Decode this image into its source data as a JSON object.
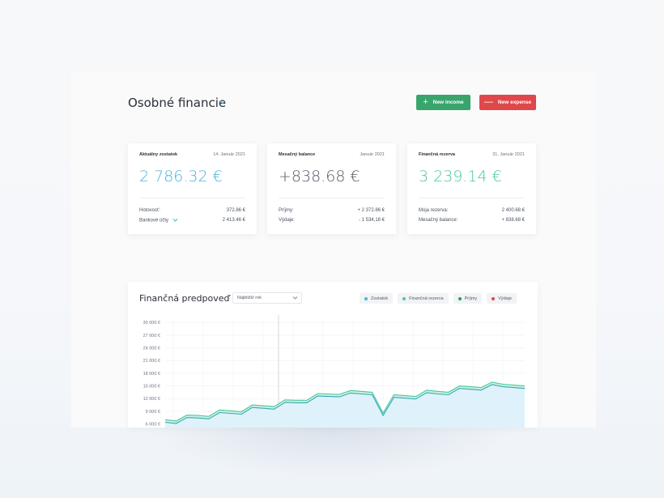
{
  "header": {
    "title": "Osobné financie",
    "new_income": "New income",
    "new_expense": "New expense"
  },
  "cards": [
    {
      "title": "Aktuálny zostatok",
      "date": "14. Január 2021",
      "amount": "2 786.32 €",
      "rows": [
        {
          "label": "Hotovosť:",
          "value": "372.86 €"
        },
        {
          "label": "Bankové účty",
          "value": "2 413.46 €"
        }
      ]
    },
    {
      "title": "Mesačný balance",
      "date": "Január 2021",
      "amount": "+838.68 €",
      "rows": [
        {
          "label": "Príjmy:",
          "value": "+ 2 372.86 €"
        },
        {
          "label": "Výdaje:",
          "value": "- 1 534,18 €"
        }
      ]
    },
    {
      "title": "Finančná rezerva",
      "date": "31. Január 2021",
      "amount": "3 239.14 €",
      "rows": [
        {
          "label": "Moja rezerva:",
          "value": "2 400.68 €"
        },
        {
          "label": "Mesačný balance:",
          "value": "+ 838.68 €"
        }
      ]
    }
  ],
  "forecast": {
    "title": "Finančná predpoveď",
    "period": "Najbližší rok",
    "legend": [
      {
        "label": "Zostatok",
        "color": "#4db3dc"
      },
      {
        "label": "Finančná rezerva",
        "color": "#48c99a"
      },
      {
        "label": "Príjmy",
        "color": "#2e9c66"
      },
      {
        "label": "Výdaje",
        "color": "#e0474a"
      }
    ]
  },
  "chart_data": {
    "type": "area",
    "yticks": [
      "30 000 €",
      "27 000 €",
      "24 000 €",
      "21 000 €",
      "18 000 €",
      "15 000 €",
      "12 000 €",
      "9 000 €",
      "6 000 €"
    ],
    "ylim": [
      4000,
      31000
    ],
    "x": [
      0,
      1,
      2,
      3,
      4,
      5,
      6,
      7,
      8,
      9,
      10,
      11,
      12,
      13,
      14,
      15,
      16,
      17,
      18,
      19,
      20,
      21,
      22,
      23,
      24,
      25,
      26,
      27,
      28,
      29,
      30,
      31,
      32,
      33
    ],
    "series": [
      {
        "name": "Zostatok",
        "values": [
          6400,
          6100,
          7500,
          7400,
          7200,
          8700,
          8500,
          8300,
          9900,
          9700,
          9500,
          11100,
          11000,
          11000,
          12600,
          12500,
          12400,
          13300,
          13100,
          12900,
          8000,
          12300,
          12100,
          11900,
          13400,
          13100,
          12900,
          14400,
          14200,
          14000,
          15300,
          14800,
          14600,
          14400
        ]
      },
      {
        "name": "Finančná rezerva",
        "values": [
          7000,
          6700,
          8100,
          8000,
          7800,
          9300,
          9100,
          8900,
          10500,
          10300,
          10100,
          11700,
          11600,
          11600,
          13200,
          13100,
          13000,
          13900,
          13700,
          13500,
          8600,
          12900,
          12700,
          12500,
          14000,
          13700,
          13500,
          15000,
          14800,
          14600,
          15900,
          15400,
          15200,
          15000
        ]
      }
    ]
  }
}
